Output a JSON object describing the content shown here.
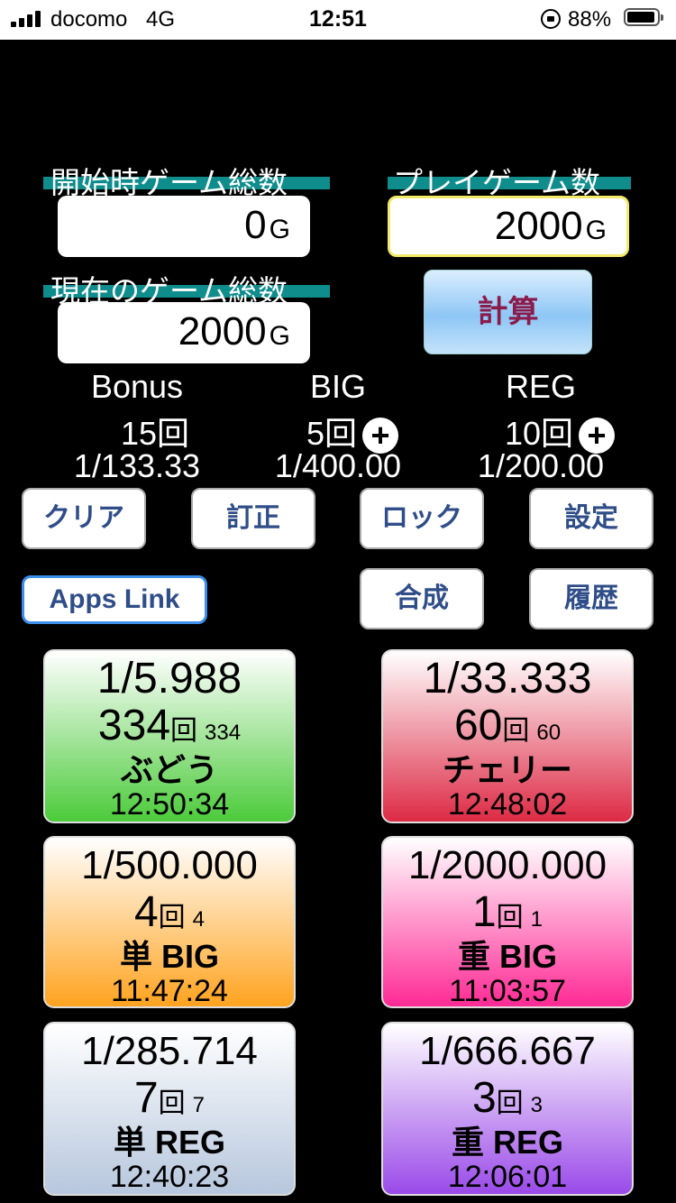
{
  "status_bar": {
    "carrier": "docomo",
    "network": "4G",
    "time": "12:51",
    "battery": "88%"
  },
  "inputs": {
    "start_total_label": "開始時ゲーム総数",
    "start_total_value": "0",
    "play_games_label": "プレイゲーム数",
    "play_games_value": "2000",
    "current_total_label": "現在のゲーム総数",
    "current_total_value": "2000",
    "unit": "G"
  },
  "calc_button": "計算",
  "summary": {
    "bonus": {
      "label": "Bonus",
      "count": "15回",
      "ratio": "1/133.33"
    },
    "big": {
      "label": "BIG",
      "count": "5回",
      "ratio": "1/400.00"
    },
    "reg": {
      "label": "REG",
      "count": "10回",
      "ratio": "1/200.00"
    }
  },
  "buttons": {
    "clear": "クリア",
    "correct": "訂正",
    "lock": "ロック",
    "settings": "設定",
    "apps_link": "Apps Link",
    "combine": "合成",
    "history": "履歴"
  },
  "counters": [
    {
      "ratio": "1/5.988",
      "count": "334",
      "unit": "回",
      "sub": "334",
      "name": "ぶどう",
      "time": "12:50:34",
      "color": "#4ccb3b"
    },
    {
      "ratio": "1/33.333",
      "count": "60",
      "unit": "回",
      "sub": "60",
      "name": "チェリー",
      "time": "12:48:02",
      "color": "#dd2a45"
    },
    {
      "ratio": "1/500.000",
      "count": "4",
      "unit": "回",
      "sub": "4",
      "name": "単 BIG",
      "time": "11:47:24",
      "color": "#ffa31f"
    },
    {
      "ratio": "1/2000.000",
      "count": "1",
      "unit": "回",
      "sub": "1",
      "name": "重 BIG",
      "time": "11:03:57",
      "color": "#ff2a95"
    },
    {
      "ratio": "1/285.714",
      "count": "7",
      "unit": "回",
      "sub": "7",
      "name": "単 REG",
      "time": "12:40:23",
      "color": "#b7c7dd"
    },
    {
      "ratio": "1/666.667",
      "count": "3",
      "unit": "回",
      "sub": "3",
      "name": "重 REG",
      "time": "12:06:01",
      "color": "#9a4ae8"
    }
  ]
}
